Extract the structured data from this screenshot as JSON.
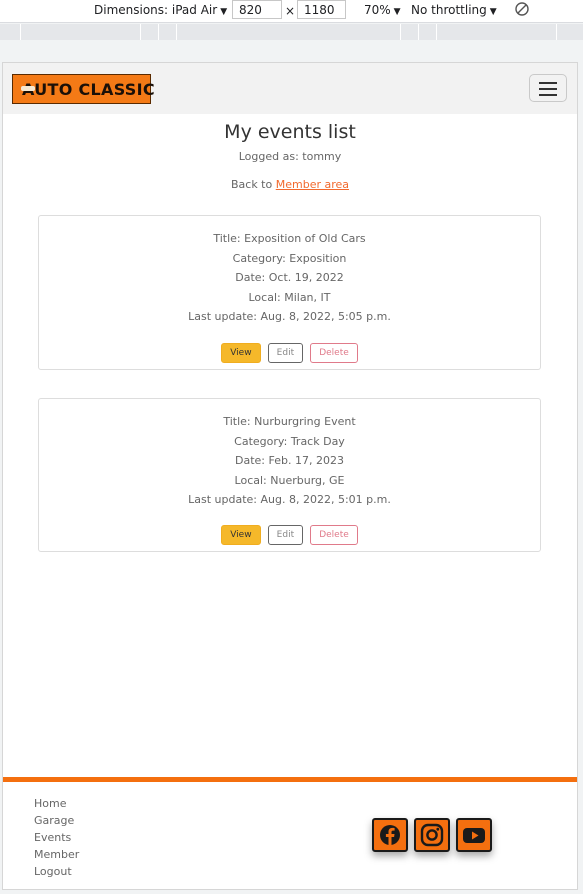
{
  "devtools": {
    "dimensions_label": "Dimensions: iPad Air",
    "width": "820",
    "times": "×",
    "height": "1180",
    "zoom": "70%",
    "throttling": "No throttling"
  },
  "brand": {
    "logo_text": "AUTO CLASSIC"
  },
  "page": {
    "title": "My events list",
    "logged_as": "Logged as: tommy",
    "back_prefix": "Back to ",
    "back_link": "Member area"
  },
  "events": [
    {
      "title": "Title: Exposition of Old Cars",
      "category": "Category: Exposition",
      "date": "Date: Oct. 19, 2022",
      "local": "Local: Milan, IT",
      "updated": "Last update: Aug. 8, 2022, 5:05 p.m."
    },
    {
      "title": "Title: Nurburgring Event",
      "category": "Category: Track Day",
      "date": "Date: Feb. 17, 2023",
      "local": "Local: Nuerburg, GE",
      "updated": "Last update: Aug. 8, 2022, 5:01 p.m."
    }
  ],
  "buttons": {
    "view": "View",
    "edit": "Edit",
    "delete": "Delete"
  },
  "footer": {
    "links": [
      "Home",
      "Garage",
      "Events",
      "Member",
      "Logout"
    ],
    "social": [
      "facebook-icon",
      "instagram-icon",
      "youtube-icon"
    ]
  },
  "colors": {
    "accent": "#f46f0f",
    "view_button": "#f5b82a"
  }
}
